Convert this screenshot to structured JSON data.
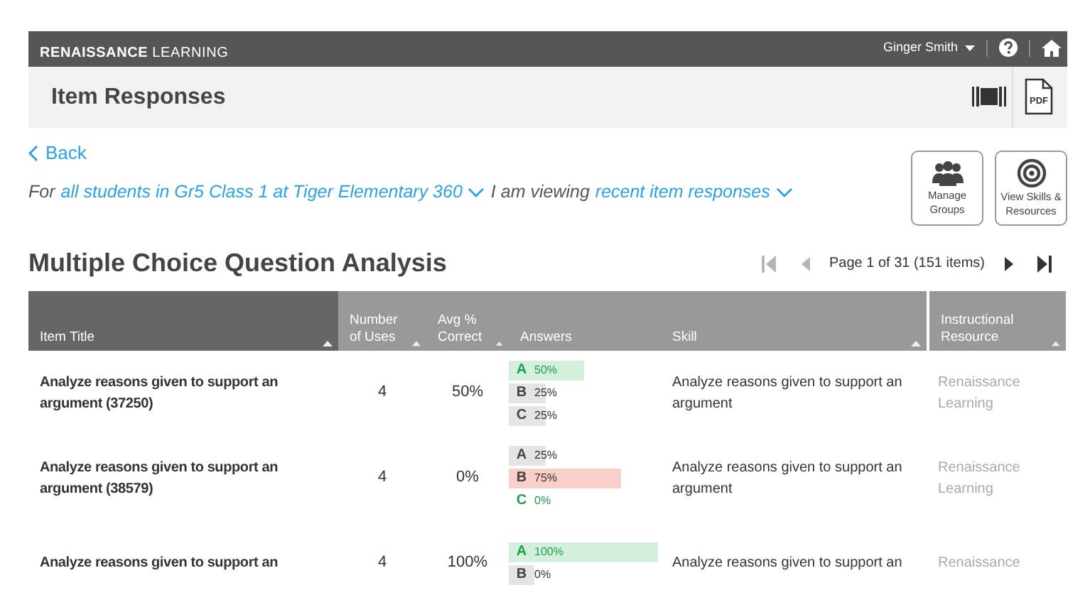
{
  "header": {
    "logo": "**RENAISSANCE** LEARNING",
    "user": "Ginger Smith"
  },
  "title_bar": {
    "title": "Item Responses",
    "pdf_label": "PDF"
  },
  "back_link": "Back",
  "filter": {
    "prefix": "For",
    "group": "all students in Gr5 Class 1 at Tiger Elementary 360",
    "middle": "I am viewing",
    "view": "recent item responses"
  },
  "actions": [
    {
      "label": "Manage Groups",
      "kind": "groups"
    },
    {
      "label": "View Skills & Resources",
      "kind": "target"
    }
  ],
  "section_title": "Multiple Choice Question Analysis",
  "pager": {
    "text": "Page 1 of 31 (151 items)",
    "buttons": [
      {
        "kind": "first",
        "disabled": true
      },
      {
        "kind": "prev",
        "disabled": true
      },
      {
        "kind": "next",
        "disabled": false
      },
      {
        "kind": "last",
        "disabled": false
      }
    ]
  },
  "table": {
    "columns": [
      {
        "label": "Item Title",
        "sortable": true,
        "sorted": true
      },
      {
        "label": "Number of Uses",
        "sortable": true,
        "sorted": false
      },
      {
        "label": "Avg % Correct",
        "sortable": true,
        "sorted": false
      },
      {
        "label": "Answers",
        "sortable": false,
        "sorted": false
      },
      {
        "label": "Skill",
        "sortable": true,
        "sorted": false
      },
      {
        "label": "Instructional Resource",
        "sortable": true,
        "sorted": false
      }
    ],
    "rows": [
      {
        "title": "Analyze reasons given to support an argument (37250)",
        "uses": "4",
        "avg": "50%",
        "answers": [
          {
            "letter": "A",
            "pct": "50%",
            "kind": "correct"
          },
          {
            "letter": "B",
            "pct": "25%",
            "kind": "wrong"
          },
          {
            "letter": "C",
            "pct": "25%",
            "kind": "wrong"
          }
        ],
        "skill": "Analyze reasons given to support an argument",
        "resource": "Renaissance Learning"
      },
      {
        "title": "Analyze reasons given to support an argument (38579)",
        "uses": "4",
        "avg": "0%",
        "answers": [
          {
            "letter": "A",
            "pct": "25%",
            "kind": "wrong"
          },
          {
            "letter": "B",
            "pct": "75%",
            "kind": "top_wrong"
          },
          {
            "letter": "C",
            "pct": "0%",
            "kind": "correct"
          }
        ],
        "skill": "Analyze reasons given to support an argument",
        "resource": "Renaissance Learning"
      },
      {
        "title": "Analyze reasons given to support an",
        "uses": "4",
        "avg": "100%",
        "answers": [
          {
            "letter": "A",
            "pct": "100%",
            "kind": "correct"
          },
          {
            "letter": "B",
            "pct": "0%",
            "kind": "wrong"
          }
        ],
        "skill": "Analyze reasons given to support an",
        "resource": "Renaissance"
      }
    ]
  }
}
